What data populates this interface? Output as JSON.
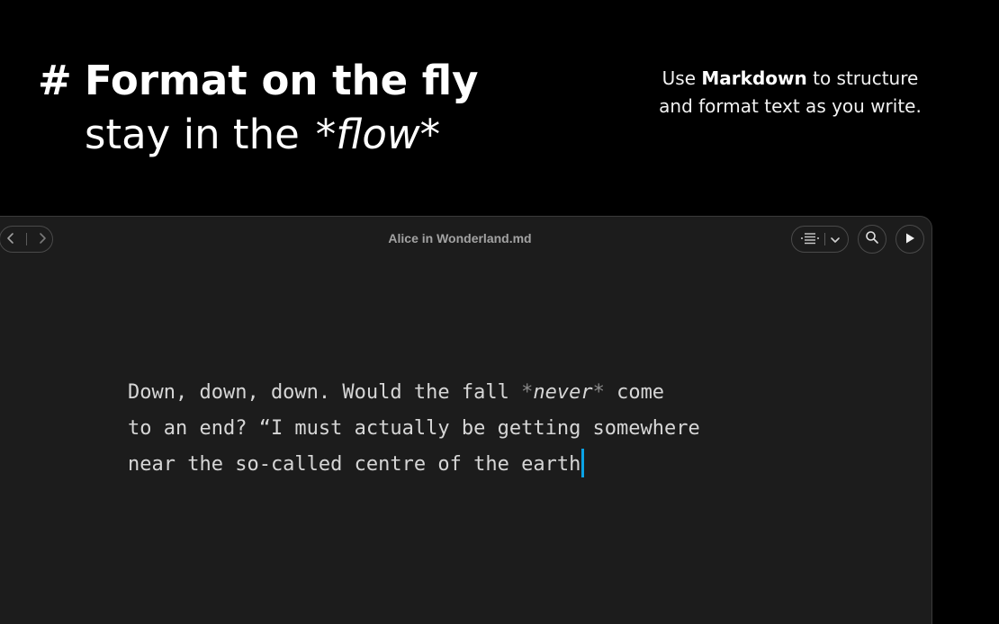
{
  "hero": {
    "hash": "#",
    "line1": "Format on the fly",
    "line2_prefix": "stay in the",
    "line2_emphasis": "*flow*"
  },
  "side_copy": {
    "text_before": "Use ",
    "bold": "Markdown",
    "text_after": " to structure",
    "line2": "and format text as you write."
  },
  "window": {
    "title": "Alice in Wonderland.md",
    "icons": {
      "back": "chevron-left-icon",
      "forward": "chevron-right-icon",
      "format": "paragraph-format-icon",
      "dropdown": "chevron-down-icon",
      "search": "search-icon",
      "play": "play-icon"
    }
  },
  "editor": {
    "line1_before": "Down, down, down. Would the fall ",
    "line1_mark_open": "*",
    "line1_emphasis": "never",
    "line1_mark_close": "*",
    "line1_after": " come",
    "line2": "to an end? “I must actually be getting somewhere",
    "line3": "near the so-called centre of the earth"
  },
  "colors": {
    "background": "#000000",
    "window": "#1c1c1c",
    "cursor": "#0aa3e6"
  }
}
